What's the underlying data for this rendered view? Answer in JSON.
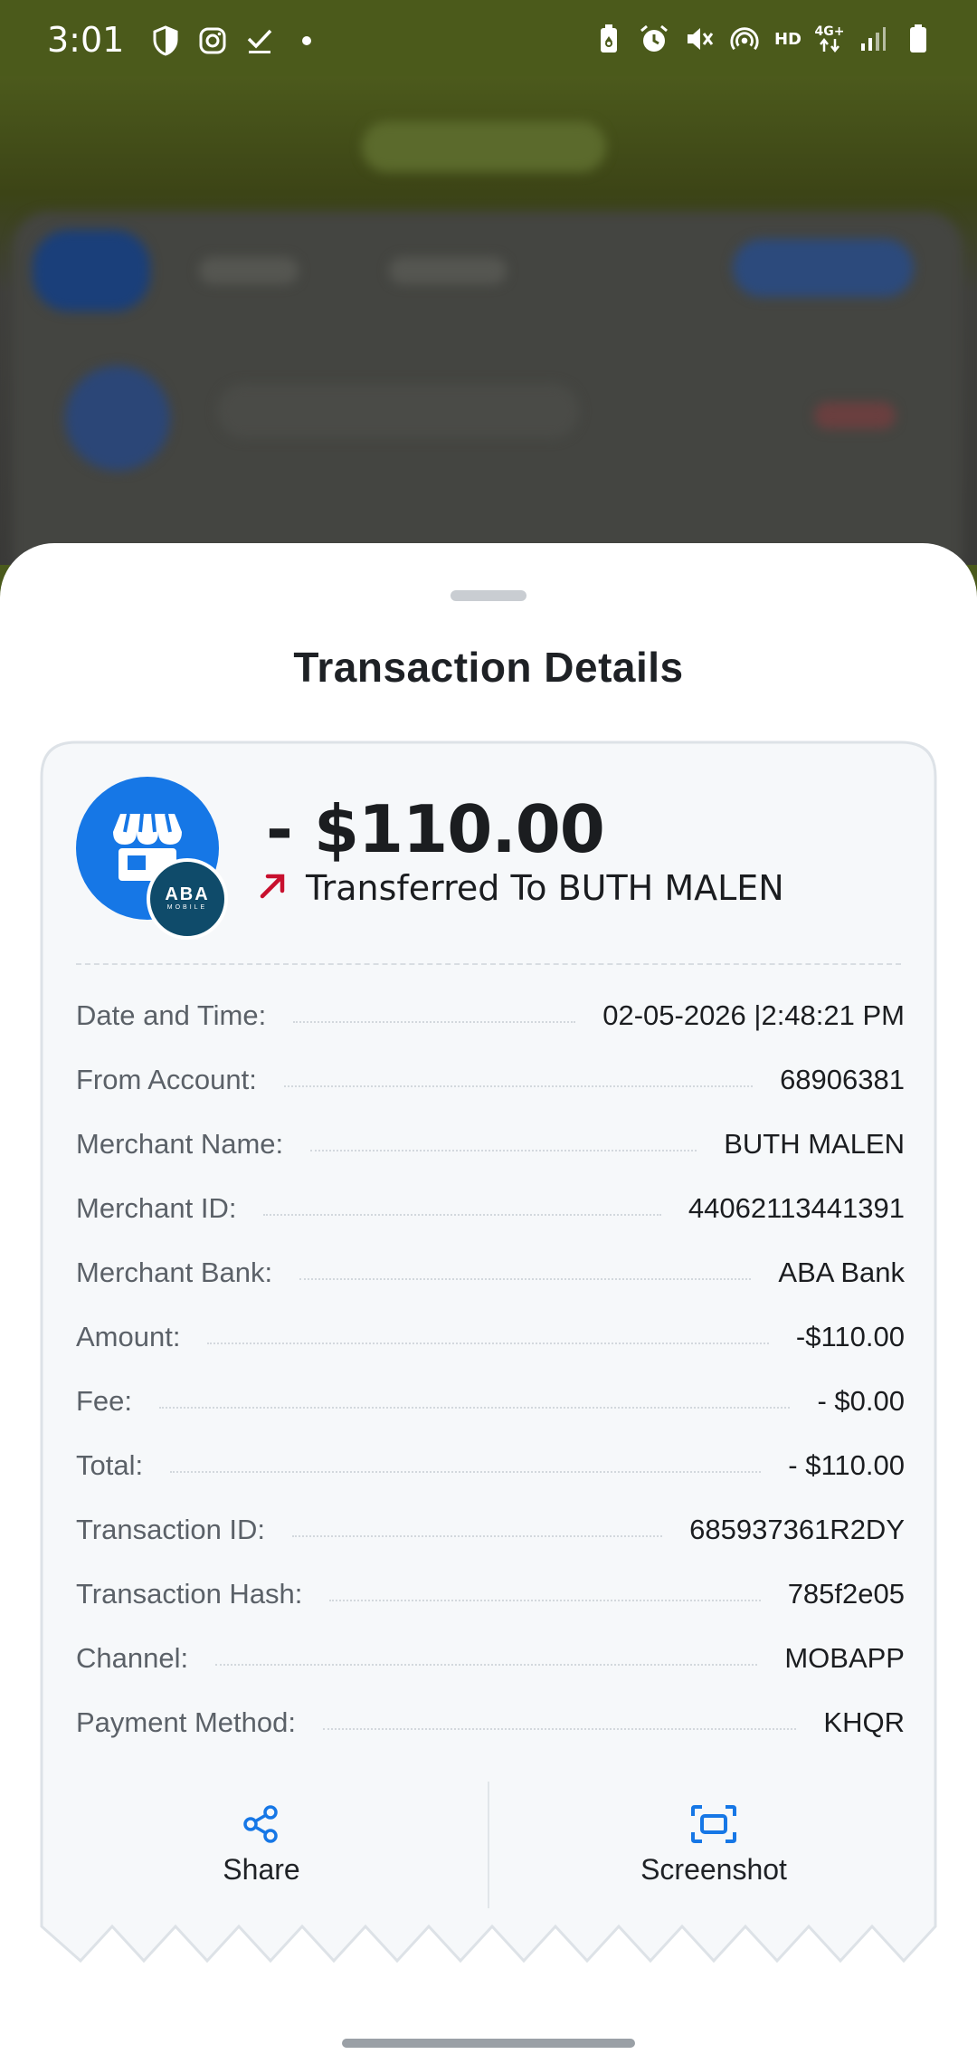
{
  "status_bar": {
    "time": "3:01",
    "left_icons": [
      "shield-icon",
      "instagram-icon",
      "check-icon",
      "dot-icon"
    ],
    "right_icons": [
      "battery-saver-icon",
      "alarm-icon",
      "mute-icon",
      "hotspot-icon",
      "hd-icon",
      "4g-icon",
      "signal-icon",
      "battery-icon"
    ],
    "hd": "HD",
    "network": "4G+"
  },
  "sheet": {
    "title": "Transaction Details"
  },
  "transaction": {
    "logo_badge": "ABA",
    "logo_badge_sub": "MOBILE",
    "amount": "- $110.00",
    "direction_icon": "arrow-up-right-icon",
    "description": "Transferred To BUTH MALEN",
    "details": [
      {
        "label": "Date and Time:",
        "value": "02-05-2026 |2:48:21 PM"
      },
      {
        "label": "From Account:",
        "value": "68906381"
      },
      {
        "label": "Merchant Name:",
        "value": "BUTH MALEN"
      },
      {
        "label": "Merchant ID:",
        "value": "44062113441391"
      },
      {
        "label": "Merchant Bank:",
        "value": "ABA Bank"
      },
      {
        "label": "Amount:",
        "value": "-$110.00"
      },
      {
        "label": "Fee:",
        "value": "- $0.00"
      },
      {
        "label": "Total:",
        "value": "- $110.00"
      },
      {
        "label": "Transaction ID:",
        "value": "685937361R2DY"
      },
      {
        "label": "Transaction Hash:",
        "value": "785f2e05"
      },
      {
        "label": "Channel:",
        "value": "MOBAPP"
      },
      {
        "label": "Payment Method:",
        "value": "KHQR"
      }
    ]
  },
  "actions": {
    "share_label": "Share",
    "screenshot_label": "Screenshot"
  },
  "colors": {
    "status_bar": "#4b5a1b",
    "accent_blue": "#1677e6",
    "arrow_red": "#c8102e",
    "badge_dark": "#0f4b6a"
  }
}
